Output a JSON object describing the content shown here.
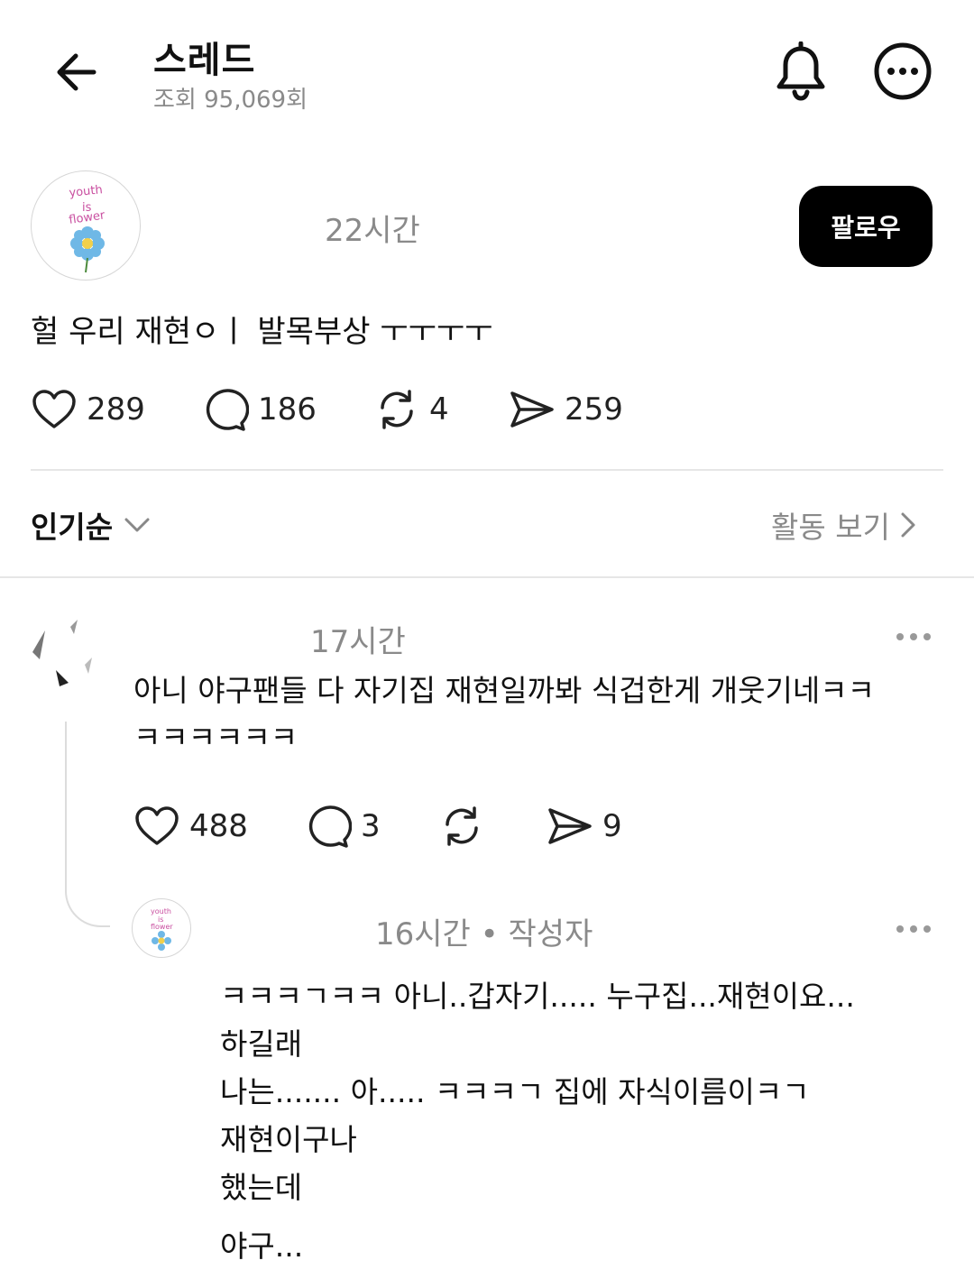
{
  "header": {
    "title": "스레드",
    "views": "조회 95,069회"
  },
  "post": {
    "time": "22시간",
    "follow_label": "팔로우",
    "text": "헐 우리 재현ㅇㅣ  발목부상 ㅜㅜㅜㅜ",
    "stats": {
      "likes": "289",
      "comments": "186",
      "reposts": "4",
      "shares": "259"
    }
  },
  "sort": {
    "label": "인기순",
    "activity": "활동 보기"
  },
  "comment": {
    "time": "17시간",
    "lines": [
      "아니 야구팬들 다 자기집 재현일까봐 식겁한게 개웃기네ㅋㅋ",
      "ㅋㅋㅋㅋㅋㅋ"
    ],
    "stats": {
      "likes": "488",
      "comments": "3",
      "shares": "9"
    }
  },
  "reply": {
    "time": "16시간",
    "author_tag": "• 작성자",
    "lines": [
      "ㅋㅋㅋㄱㅋㅋ  아니..갑자기..... 누구집...재현이요...",
      "하길래",
      "나는....... 아..... ㅋㅋㅋㄱ 집에 자식이름이ㅋㄱ",
      "재현이구나",
      "했는데",
      "야구..."
    ]
  },
  "avatar_art": {
    "text": [
      "youth",
      "is",
      "flower"
    ],
    "ink": "#c94fa0",
    "flower": "#6fb8e6"
  },
  "colors": {
    "text": "#111111",
    "muted": "#8a8a8a",
    "divider": "#e6e6e6",
    "button": "#000000"
  }
}
